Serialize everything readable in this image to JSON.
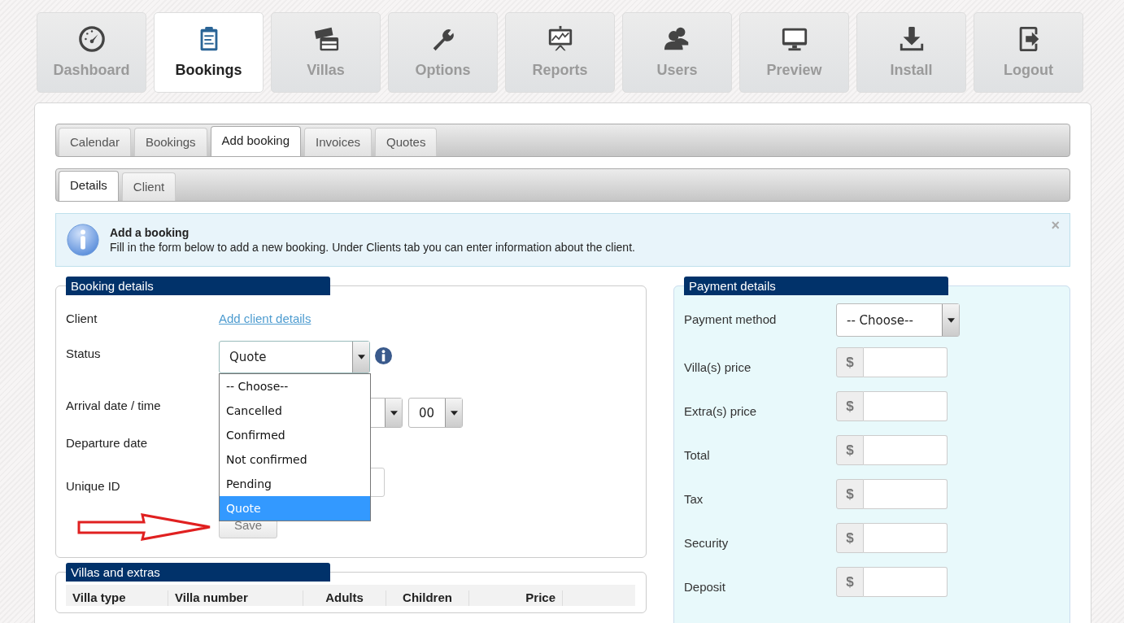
{
  "nav": [
    {
      "label": "Dashboard",
      "selected": false
    },
    {
      "label": "Bookings",
      "selected": true
    },
    {
      "label": "Villas",
      "selected": false
    },
    {
      "label": "Options",
      "selected": false
    },
    {
      "label": "Reports",
      "selected": false
    },
    {
      "label": "Users",
      "selected": false
    },
    {
      "label": "Preview",
      "selected": false
    },
    {
      "label": "Install",
      "selected": false
    },
    {
      "label": "Logout",
      "selected": false
    }
  ],
  "tabs": [
    {
      "label": "Calendar",
      "selected": false
    },
    {
      "label": "Bookings",
      "selected": false
    },
    {
      "label": "Add booking",
      "selected": true
    },
    {
      "label": "Invoices",
      "selected": false
    },
    {
      "label": "Quotes",
      "selected": false
    }
  ],
  "subtabs": [
    {
      "label": "Details",
      "selected": true
    },
    {
      "label": "Client",
      "selected": false
    }
  ],
  "notice": {
    "title": "Add a booking",
    "text": "Fill in the form below to add a new booking. Under Clients tab you can enter information about the client.",
    "close": "×"
  },
  "booking_details": {
    "legend": "Booking details",
    "client_label": "Client",
    "client_link": "Add client details",
    "status_label": "Status",
    "status_value": "Quote",
    "status_options": [
      {
        "label": "-- Choose--",
        "selected": false
      },
      {
        "label": "Cancelled",
        "selected": false
      },
      {
        "label": "Confirmed",
        "selected": false
      },
      {
        "label": "Not confirmed",
        "selected": false
      },
      {
        "label": "Pending",
        "selected": false
      },
      {
        "label": "Quote",
        "selected": true
      }
    ],
    "arrival_label": "Arrival date / time",
    "minute_value": "00",
    "departure_label": "Departure date",
    "unique_id_label": "Unique ID",
    "save_button": "Save"
  },
  "villas_extras": {
    "legend": "Villas and extras",
    "columns": [
      "Villa type",
      "Villa number",
      "Adults",
      "Children",
      "Price"
    ]
  },
  "payment_details": {
    "legend": "Payment details",
    "method_label": "Payment method",
    "method_value": "-- Choose--",
    "currency": "$",
    "fields": [
      {
        "label": "Villa(s) price"
      },
      {
        "label": "Extra(s) price"
      },
      {
        "label": "Total"
      },
      {
        "label": "Tax"
      },
      {
        "label": "Security"
      },
      {
        "label": "Deposit"
      }
    ]
  }
}
